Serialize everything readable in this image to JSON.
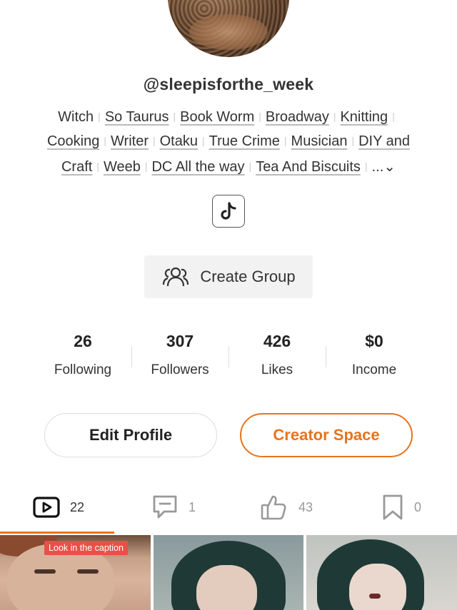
{
  "profile": {
    "username": "@sleepisforthe_week"
  },
  "tags": {
    "row1": [
      "Witch",
      "So Taurus",
      "Book Worm",
      "Broadway",
      "Knitting"
    ],
    "row2": [
      "Cooking",
      "Writer",
      "Otaku",
      "True Crime",
      "Musician",
      "DIY and"
    ],
    "row3": [
      "Craft",
      "Weeb",
      "DC All the way",
      "Tea And Biscuits"
    ],
    "more": "...⌄"
  },
  "social": {
    "icon": "tiktok-icon"
  },
  "group_button": {
    "label": "Create Group",
    "icon": "group-icon"
  },
  "stats": {
    "following": {
      "value": "26",
      "label": "Following"
    },
    "followers": {
      "value": "307",
      "label": "Followers"
    },
    "likes": {
      "value": "426",
      "label": "Likes"
    },
    "income": {
      "value": "$0",
      "label": "Income"
    }
  },
  "actions": {
    "edit_profile": "Edit Profile",
    "creator_space": "Creator Space"
  },
  "tabs": [
    {
      "icon": "video-icon",
      "count": "22",
      "active": true
    },
    {
      "icon": "comment-icon",
      "count": "1",
      "active": false
    },
    {
      "icon": "thumbs-up-icon",
      "count": "43",
      "active": false
    },
    {
      "icon": "bookmark-icon",
      "count": "0",
      "active": false
    }
  ],
  "thumbnails": {
    "first_badge": "Look in the caption"
  },
  "colors": {
    "accent": "#e8731c",
    "badge": "#e8504a"
  }
}
